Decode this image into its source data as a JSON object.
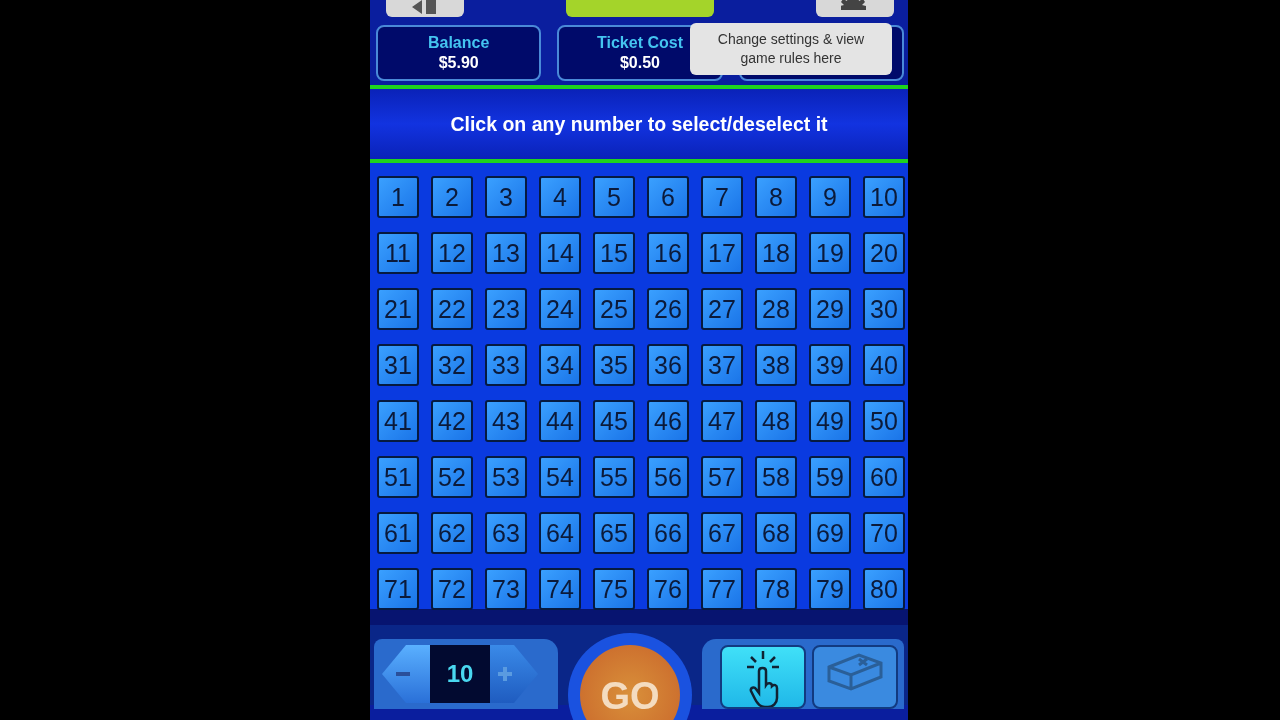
{
  "stats": [
    {
      "label": "Balance",
      "value": "$5.90"
    },
    {
      "label": "Ticket Cost",
      "value": "$0.50"
    }
  ],
  "tooltip": "Change settings & view game rules here",
  "instruction": "Click on any number to select/deselect it",
  "numbers": [
    {
      "label": "1",
      "selected": false
    },
    {
      "label": "2",
      "selected": false
    },
    {
      "label": "3",
      "selected": false
    },
    {
      "label": "4",
      "selected": false
    },
    {
      "label": "5",
      "selected": false
    },
    {
      "label": "6",
      "selected": false
    },
    {
      "label": "7",
      "selected": false
    },
    {
      "label": "8",
      "selected": false
    },
    {
      "label": "9",
      "selected": false
    },
    {
      "label": "10",
      "selected": false
    },
    {
      "label": "11",
      "selected": false
    },
    {
      "label": "12",
      "selected": false
    },
    {
      "label": "13",
      "selected": false
    },
    {
      "label": "14",
      "selected": false
    },
    {
      "label": "15",
      "selected": false
    },
    {
      "label": "16",
      "selected": false
    },
    {
      "label": "17",
      "selected": false
    },
    {
      "label": "18",
      "selected": false
    },
    {
      "label": "19",
      "selected": false
    },
    {
      "label": "20",
      "selected": false
    },
    {
      "label": "21",
      "selected": false
    },
    {
      "label": "22",
      "selected": false
    },
    {
      "label": "23",
      "selected": false
    },
    {
      "label": "24",
      "selected": false
    },
    {
      "label": "25",
      "selected": false
    },
    {
      "label": "26",
      "selected": false
    },
    {
      "label": "27",
      "selected": false
    },
    {
      "label": "28",
      "selected": false
    },
    {
      "label": "29",
      "selected": false
    },
    {
      "label": "30",
      "selected": false
    },
    {
      "label": "31",
      "selected": false
    },
    {
      "label": "32",
      "selected": false
    },
    {
      "label": "33",
      "selected": false
    },
    {
      "label": "34",
      "selected": false
    },
    {
      "label": "35",
      "selected": false
    },
    {
      "label": "36",
      "selected": false
    },
    {
      "label": "37",
      "selected": false
    },
    {
      "label": "38",
      "selected": false
    },
    {
      "label": "39",
      "selected": false
    },
    {
      "label": "40",
      "selected": false
    },
    {
      "label": "41",
      "selected": false
    },
    {
      "label": "42",
      "selected": false
    },
    {
      "label": "43",
      "selected": false
    },
    {
      "label": "44",
      "selected": false
    },
    {
      "label": "45",
      "selected": false
    },
    {
      "label": "46",
      "selected": false
    },
    {
      "label": "47",
      "selected": false
    },
    {
      "label": "48",
      "selected": false
    },
    {
      "label": "49",
      "selected": false
    },
    {
      "label": "50",
      "selected": false
    },
    {
      "label": "51",
      "selected": false
    },
    {
      "label": "52",
      "selected": false
    },
    {
      "label": "53",
      "selected": false
    },
    {
      "label": "54",
      "selected": false
    },
    {
      "label": "55",
      "selected": false
    },
    {
      "label": "56",
      "selected": false
    },
    {
      "label": "57",
      "selected": false
    },
    {
      "label": "58",
      "selected": false
    },
    {
      "label": "59",
      "selected": false
    },
    {
      "label": "60",
      "selected": false
    },
    {
      "label": "61",
      "selected": false
    },
    {
      "label": "62",
      "selected": false
    },
    {
      "label": "63",
      "selected": false
    },
    {
      "label": "64",
      "selected": false
    },
    {
      "label": "65",
      "selected": false
    },
    {
      "label": "66",
      "selected": false
    },
    {
      "label": "67",
      "selected": false
    },
    {
      "label": "68",
      "selected": false
    },
    {
      "label": "69",
      "selected": false
    },
    {
      "label": "70",
      "selected": false
    },
    {
      "label": "71",
      "selected": false
    },
    {
      "label": "72",
      "selected": false
    },
    {
      "label": "73",
      "selected": false
    },
    {
      "label": "74",
      "selected": false
    },
    {
      "label": "75",
      "selected": false
    },
    {
      "label": "76",
      "selected": false
    },
    {
      "label": "77",
      "selected": false
    },
    {
      "label": "78",
      "selected": false
    },
    {
      "label": "79",
      "selected": false
    },
    {
      "label": "80",
      "selected": false
    }
  ],
  "spots": {
    "value": "10"
  },
  "go_button": "GO",
  "tools": [
    {
      "kind": "pick",
      "selected": true
    },
    {
      "kind": "clear",
      "selected": false
    }
  ]
}
